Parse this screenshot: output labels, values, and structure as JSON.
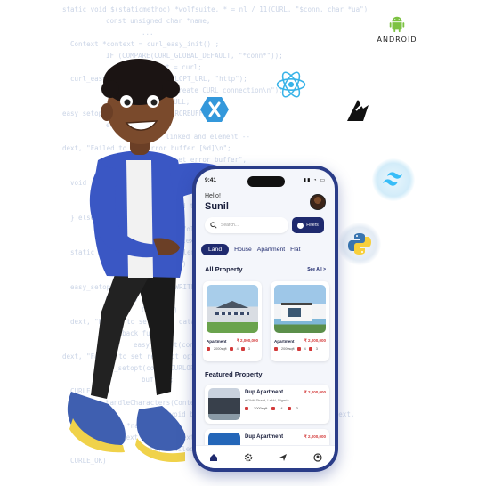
{
  "code_lines": [
    "static void $(staticmethod) *wolfsuite, * = nl / 11(CURL, \"$conn, char *ua\")",
    "  const unsigned char *name,",
    "  ...",
    "  Context *context = curl_easy_init() ;",
    "  IF (COMPARE(CURL_GLOBAL_DEFAULT, \"*conn*\"));",
    "  context = curl;",
    "  curl_easy_setopt(curl, CURLOPT_URL, \"http\");",
    "  dext, \"Failed to create CURL connection\\n\");",
    "  return NULL;",
    "easy_setopt(conn, CURLOPT_ERRORBUFFER,",
    "  error_buffer);",
    "  // -- linked and element --",
    "dext, \"Failed to set error buffer [%d]\\n\";",
    "  dext, \"Failed to set error buffer\",",
    "CURLE_OK)",
    "  void *conn",
    "  false; ...",
    "dext, \"Failed to set write",
    "  } else {",
    "dext, \"Failed to set follow",
    "  context, *text",
    "  static void bufcallback_endElement(void *voidContext,",
    "  const xmlChar *name)",
    "  FAILURE;",
    "  easy_setopt(conn, CURLOPT_WRITEFUNCTION,",
    "  writer);",
    "  CURLE_OK)",
    "  dext, \"Failed to set write data [%d]\\n\"",
    "  callback function",
    "easy_setopt(conn, CURLOPT_FOLLOWLOCATION, 1L);",
    "dext, \"Failed to set redirect option [%s]\\n\"",
    "easy_setopt(conn, CURLOPT_WRITEDATA,",
    "  buffer);",
    "  CURLE_OK)",
    "  handleCharacters(Context *context, char, length)",
    "  static void bufcallback_endElement(void *voidContext,",
    "  const xmlChar *name)",
    "  (Context *)voidContext;",
    "  dext, \"Failed to set write data [%s]\"",
    "  CURLE_OK)"
  ],
  "logos": {
    "android": "android-logo",
    "android_text": "ANDROID",
    "react": "react-logo",
    "xamarin": "xamarin-logo",
    "ionic": "ionic-logo",
    "tailwind": "tailwind-logo",
    "python": "python-logo"
  },
  "phone": {
    "status_time": "9:41",
    "greeting": "Hello!",
    "user_name": "Sunil",
    "search_placeholder": "Search...",
    "filters_label": "Filters",
    "tabs": [
      {
        "label": "Land",
        "active": true
      },
      {
        "label": "House",
        "active": false
      },
      {
        "label": "Apartment",
        "active": false
      },
      {
        "label": "Flat",
        "active": false
      }
    ],
    "all_property_title": "All Property",
    "see_all_label": "See All >",
    "cards": [
      {
        "type": "Apartment",
        "price": "₹ 2,000,000",
        "area": "2000sqft",
        "beds": "4",
        "baths": "3"
      },
      {
        "type": "Apartment",
        "price": "₹ 2,000,000",
        "area": "2000sqft",
        "beds": "4",
        "baths": "3"
      }
    ],
    "featured_title": "Featured Property",
    "featured": [
      {
        "title": "Dup Apartment",
        "price": "₹ 2,000,000",
        "address": "Dhiti Street, Lekki, Nigeria",
        "area": "2000sqft",
        "beds": "4",
        "baths": "3"
      },
      {
        "title": "Dup Apartment",
        "price": "₹ 2,000,000"
      }
    ]
  },
  "colors": {
    "primary": "#1f2a6e",
    "price_red": "#d33a3a",
    "phone_frame": "#2a3c88",
    "code_text": "#b9c6de"
  }
}
